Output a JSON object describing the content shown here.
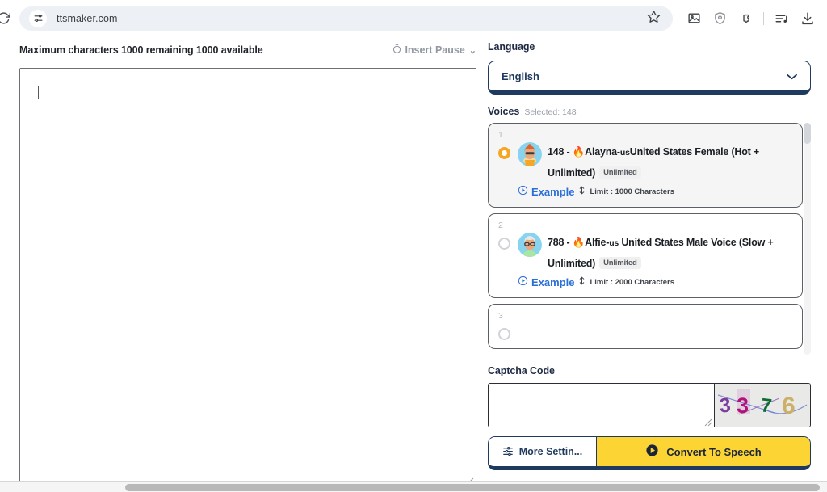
{
  "browser": {
    "url": "ttsmaker.com",
    "reload_icon": "reload-icon",
    "site_settings_icon": "site-settings-icon",
    "bookmark_icon": "star-icon",
    "toolbar_icons": [
      {
        "name": "image-icon"
      },
      {
        "name": "shield-icon"
      },
      {
        "name": "extensions-puzzle-icon"
      },
      {
        "name": "media-playlist-icon"
      },
      {
        "name": "download-icon"
      }
    ]
  },
  "editor": {
    "chars_label": "Maximum characters 1000 remaining 1000 available",
    "insert_pause_label": "Insert Pause",
    "insert_pause_caret": "⌄",
    "text_value": "",
    "placeholder": ""
  },
  "language": {
    "label": "Language",
    "value": "English",
    "caret": "⌄"
  },
  "voices": {
    "title": "Voices",
    "selected_label": "Selected: 148",
    "items": [
      {
        "index": "1",
        "selected": true,
        "title_main": "148 - 🔥Alayna-",
        "title_sub": "us",
        "title_rest": "United States Female (Hot + Unlimited)",
        "badge": "Unlimited",
        "example_label": "Example",
        "limit_label": "Limit : 1000 Characters"
      },
      {
        "index": "2",
        "selected": false,
        "title_main": "788 - 🔥Alfie-",
        "title_sub": "us",
        "title_rest": " United States Male Voice (Slow + Unlimited)",
        "badge": "Unlimited",
        "example_label": "Example",
        "limit_label": "Limit : 2000 Characters"
      },
      {
        "index": "3",
        "selected": false,
        "title_main": "",
        "title_sub": "",
        "title_rest": "",
        "badge": "",
        "example_label": "",
        "limit_label": ""
      }
    ]
  },
  "captcha": {
    "label": "Captcha Code",
    "input_value": "",
    "image_text": "3376",
    "chars": [
      {
        "glyph": "3",
        "color": "#7a3f9d"
      },
      {
        "glyph": "3",
        "color": "#b2117a"
      },
      {
        "glyph": "7",
        "color": "#0d6b35"
      },
      {
        "glyph": "6",
        "color": "#cbb06a"
      }
    ]
  },
  "actions": {
    "more_settings_label": "More Settin...",
    "more_settings_icon": "sliders-icon",
    "convert_label": "Convert To Speech",
    "convert_icon": "play-icon",
    "convert_color": "#fcd535"
  },
  "colors": {
    "accent_navy": "#1e3a5f",
    "accent_yellow": "#fcd535",
    "link_blue": "#2a6fd6",
    "radio_on": "#f5a623"
  }
}
